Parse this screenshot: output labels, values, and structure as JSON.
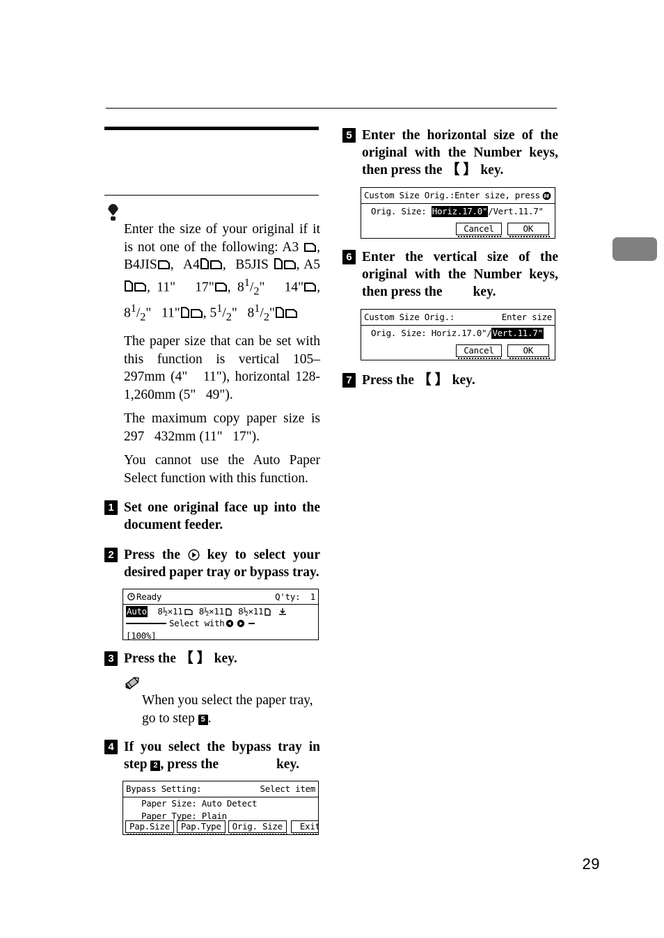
{
  "page": {
    "number": "29"
  },
  "left_column": {
    "notice": {
      "icon": "important-balloon-icon",
      "paragraphs": [
        {
          "id": "p1",
          "text_before_icons": "Enter the size of your original if it is not one of the following: A3 ",
          "full_text": "Enter the size of your original if it is not one of the following: A3 ⊐, B4JIS⊐, A4⊓⊐, B5JIS ⊓⊐, A5⊓⊐, 11\" × 17\"⊐, 8 1/2\" × 14\"⊐, 8 1/2\" × 11\"⊓⊐, 5 1/2\" × 8 1/2\"⊓⊐"
        },
        {
          "id": "p2",
          "full_text": "The paper size that can be set with this function is vertical 105–297mm (4\" × 11\"), horizontal 128-1,260mm (5\" × 49\")."
        },
        {
          "id": "p3",
          "full_text": "The maximum copy paper size is 297 × 432mm (11\" × 17\")."
        },
        {
          "id": "p4",
          "full_text": "You cannot use the Auto Paper Select function with this function."
        }
      ],
      "sizes_line1_a": "A3",
      "sizes_line2": [
        "B4JIS",
        "A4",
        "B5JIS"
      ],
      "sizes_line3": [
        "A5",
        "11\"",
        "17\"",
        "14\""
      ],
      "sizes_line4": [
        "11\"",
        "5",
        "8"
      ]
    },
    "steps": [
      {
        "num": "1",
        "text": "Set one original face up into the document feeder."
      },
      {
        "num": "2",
        "text_a": "Press the",
        "icon": "right-arrow-circle-icon",
        "text_b": "key to select your desired paper tray or bypass tray."
      },
      {
        "num": "3",
        "text_a": "Press the",
        "key": "【  】",
        "text_b": "key."
      },
      {
        "num": "4",
        "text_a": "If you select the bypass tray in step",
        "ref": "2",
        "text_b": ", press the",
        "text_c": "key."
      }
    ],
    "note": {
      "icon": "pencil-note-icon",
      "text_a": "When you select the paper tray, go to step",
      "ref": "5",
      "text_b": "."
    },
    "lcd_ready": {
      "name": "ready-screen",
      "status": "Ready",
      "status_icon": "clock-icon",
      "qty_label": "Q'ty:",
      "qty_value": "1",
      "tray_auto": "Auto",
      "trays": [
        {
          "size": "8½×11",
          "orient": "landscape"
        },
        {
          "size": "8½×11",
          "orient": "portrait"
        },
        {
          "size": "8½×11",
          "orient": "portrait"
        }
      ],
      "bypass_icon": "bypass-tray-icon",
      "hint": "Select with",
      "hint_icons": [
        "left-arrow-circle-icon",
        "right-arrow-circle-icon"
      ],
      "zoom": "[100%]"
    },
    "lcd_bypass": {
      "name": "bypass-setting-screen",
      "title": "Bypass Setting:",
      "header_right": "Select item",
      "rows": [
        {
          "label": "Paper Size:",
          "value": "Auto Detect"
        },
        {
          "label": "Paper Type:",
          "value": "Plain"
        }
      ],
      "buttons": [
        "Pap.Size",
        "Pap.Type",
        "Orig. Size",
        "Exit"
      ]
    }
  },
  "right_column": {
    "steps": [
      {
        "num": "5",
        "text_a": "Enter the horizontal size of the original with the Number keys, then press the",
        "key": "【  】",
        "text_b": "key."
      },
      {
        "num": "6",
        "text_a": "Enter the vertical size of the original with the Number keys, then press the",
        "text_b": "key."
      },
      {
        "num": "7",
        "text_a": "Press the",
        "key": "【    】",
        "text_b": "key."
      }
    ],
    "lcd_custom_h": {
      "name": "custom-size-horizontal-screen",
      "title": "Custom Size Orig.:",
      "header_right": "Enter size, press",
      "header_icon": "hash-key-icon",
      "field_label": "Orig. Size:",
      "horiz_value": "Horiz.17.0\"",
      "separator": "/",
      "vert_value": "Vert.11.7\"",
      "selected": "horiz",
      "buttons": [
        "Cancel",
        "OK"
      ]
    },
    "lcd_custom_v": {
      "name": "custom-size-vertical-screen",
      "title": "Custom Size Orig.:",
      "header_right": "Enter size",
      "field_label": "Orig. Size:",
      "horiz_value": "Horiz.17.0\"",
      "separator": "/",
      "vert_value": "Vert.11.7\"",
      "selected": "vert",
      "buttons": [
        "Cancel",
        "OK"
      ]
    }
  }
}
